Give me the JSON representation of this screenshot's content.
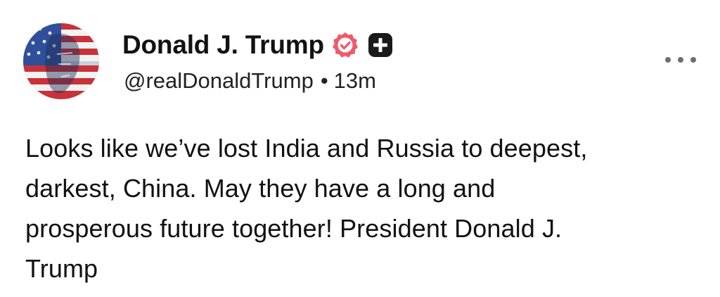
{
  "author": {
    "display_name": "Donald J. Trump",
    "handle": "@realDonaldTrump",
    "separator": "•",
    "time_ago": "13m",
    "avatar_icon": "flag-portrait-avatar",
    "badge_icon": "verified-badge-icon",
    "badge_color": "#ee5b6a",
    "plus_icon": "plus-badge-icon",
    "plus_color": "#1a1a1a"
  },
  "menu": {
    "icon": "more-options-icon"
  },
  "post": {
    "lines": [
      "Looks like we’ve lost India and Russia to deepest,",
      "darkest, China. May they have a long and",
      "prosperous future together! President Donald J.",
      "Trump"
    ]
  }
}
